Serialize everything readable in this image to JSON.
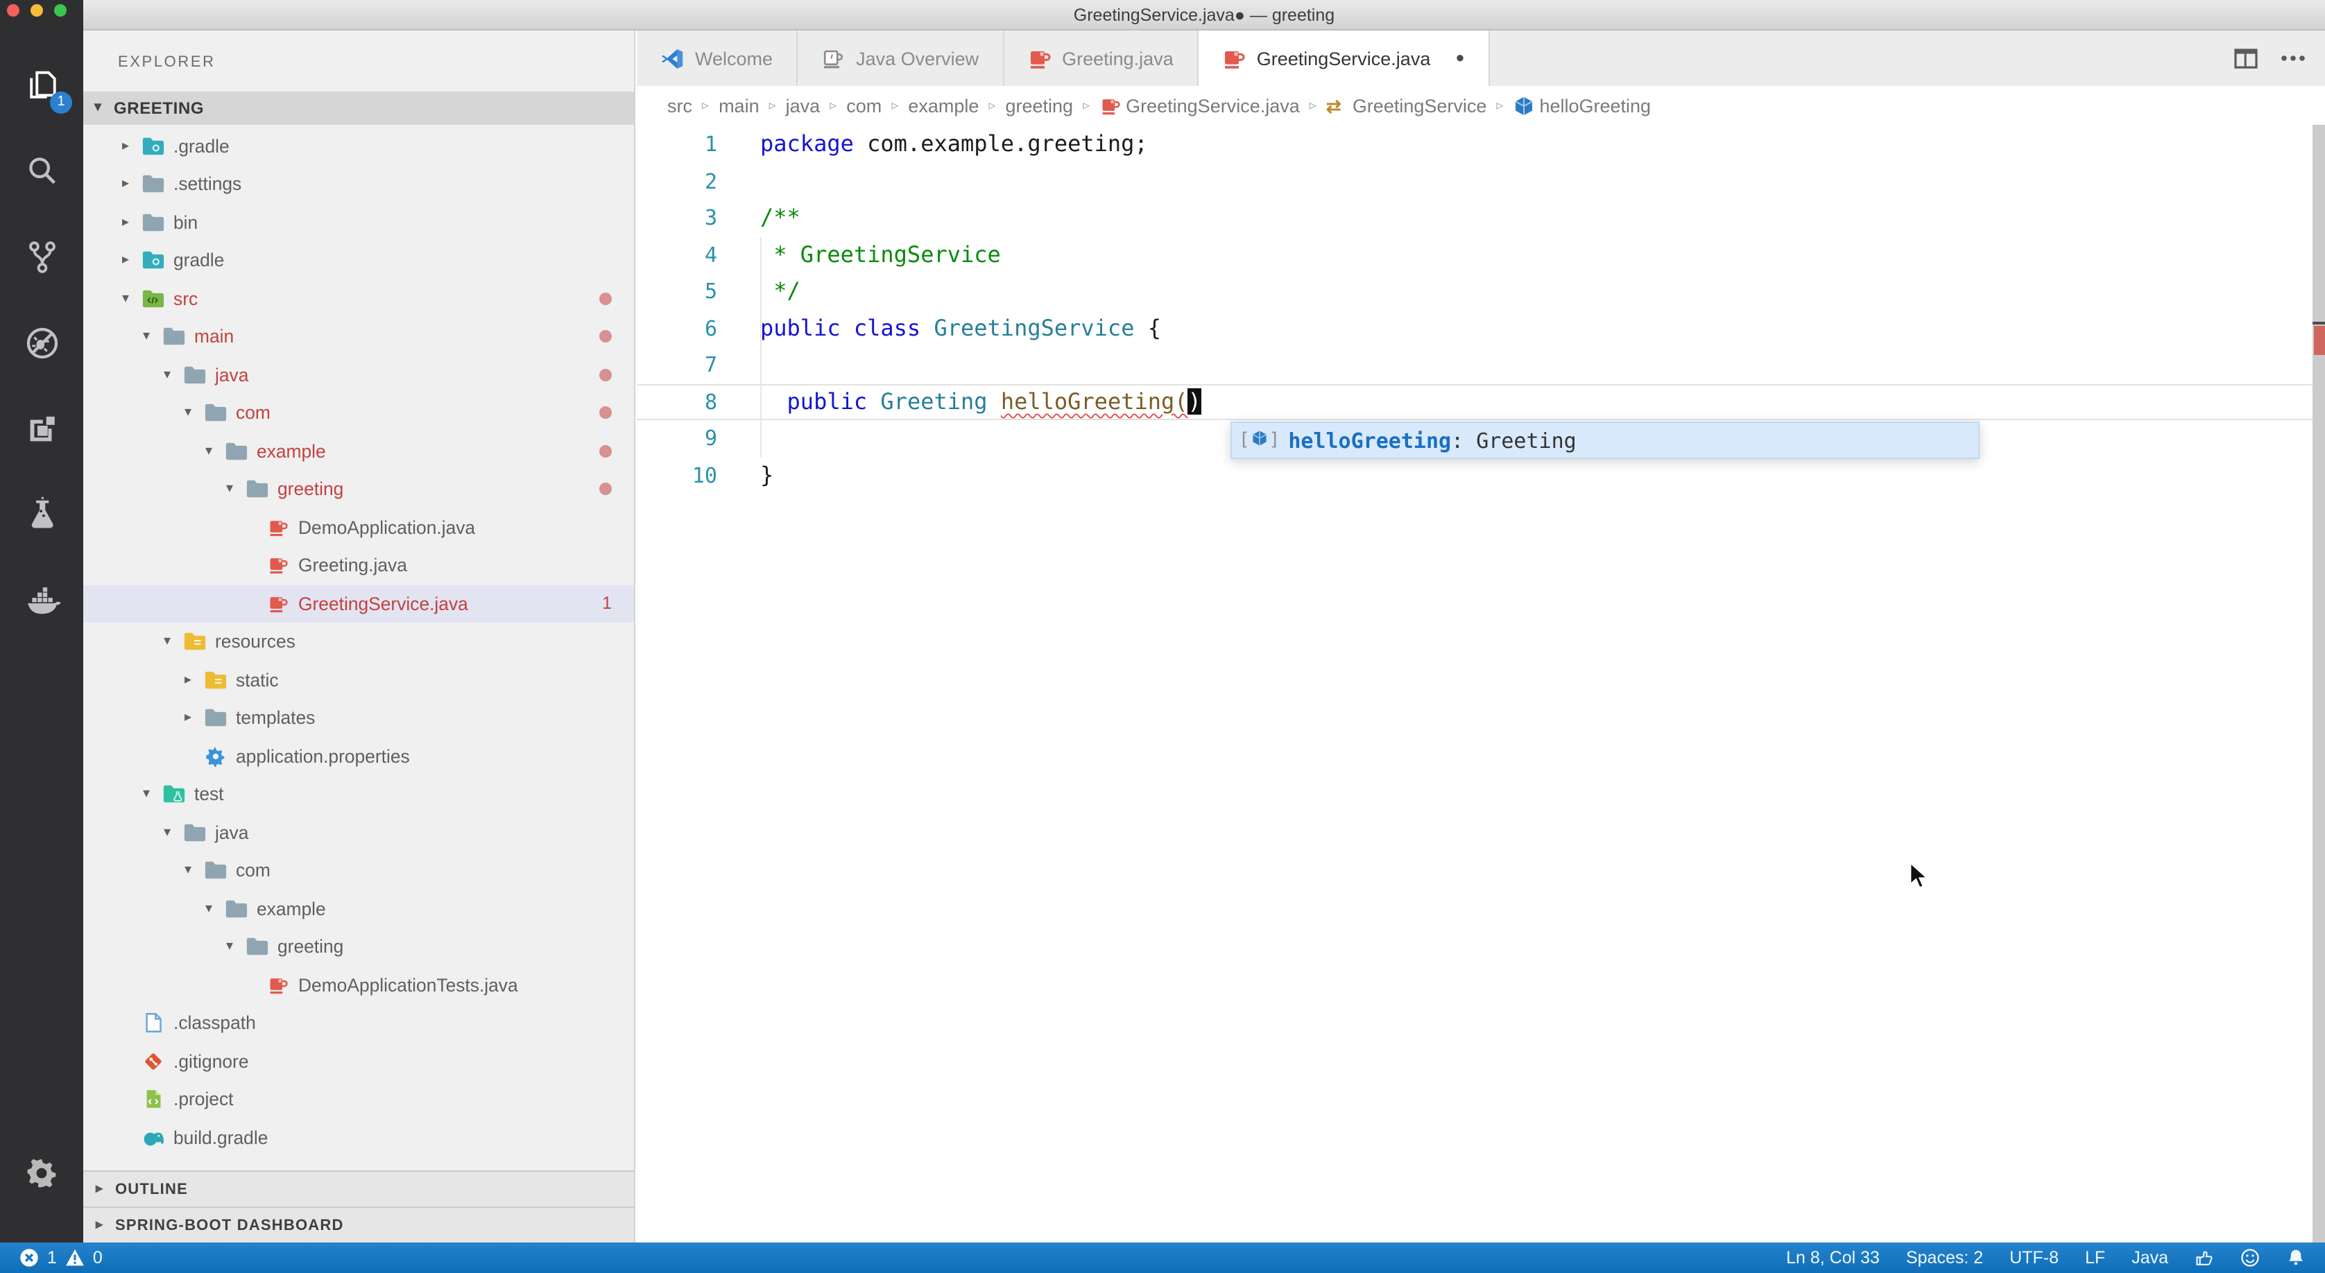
{
  "window": {
    "title": "GreetingService.java● — greeting"
  },
  "activity_bar": {
    "items": [
      {
        "name": "files",
        "active": true,
        "badge": "1"
      },
      {
        "name": "search"
      },
      {
        "name": "source-control"
      },
      {
        "name": "debug"
      },
      {
        "name": "extensions"
      },
      {
        "name": "test"
      },
      {
        "name": "docker"
      }
    ],
    "settings": {
      "name": "settings-gear"
    }
  },
  "sidebar": {
    "title": "EXPLORER",
    "section": "GREETING",
    "tree": [
      {
        "label": ".gradle",
        "level": 1,
        "icon": "gradle-folder",
        "arrow": "closed"
      },
      {
        "label": ".settings",
        "level": 1,
        "icon": "folder",
        "arrow": "closed"
      },
      {
        "label": "bin",
        "level": 1,
        "icon": "folder",
        "arrow": "closed"
      },
      {
        "label": "gradle",
        "level": 1,
        "icon": "gradle-folder",
        "arrow": "closed"
      },
      {
        "label": "src",
        "level": 1,
        "icon": "src-folder",
        "arrow": "open",
        "red": true,
        "dot": true
      },
      {
        "label": "main",
        "level": 2,
        "icon": "folder",
        "arrow": "open",
        "red": true,
        "dot": true
      },
      {
        "label": "java",
        "level": 3,
        "icon": "folder",
        "arrow": "open",
        "red": true,
        "dot": true
      },
      {
        "label": "com",
        "level": 4,
        "icon": "folder",
        "arrow": "open",
        "red": true,
        "dot": true
      },
      {
        "label": "example",
        "level": 5,
        "icon": "folder",
        "arrow": "open",
        "red": true,
        "dot": true
      },
      {
        "label": "greeting",
        "level": 6,
        "icon": "folder",
        "arrow": "open",
        "red": true,
        "dot": true
      },
      {
        "label": "DemoApplication.java",
        "level": 7,
        "icon": "java-file",
        "arrow": "none"
      },
      {
        "label": "Greeting.java",
        "level": 7,
        "icon": "java-file",
        "arrow": "none"
      },
      {
        "label": "GreetingService.java",
        "level": 7,
        "icon": "java-file",
        "arrow": "none",
        "red": true,
        "selected": true,
        "badge": "1"
      },
      {
        "label": "resources",
        "level": 3,
        "icon": "resources-folder",
        "arrow": "open"
      },
      {
        "label": "static",
        "level": 4,
        "icon": "resources-folder",
        "arrow": "closed"
      },
      {
        "label": "templates",
        "level": 4,
        "icon": "folder",
        "arrow": "closed"
      },
      {
        "label": "application.properties",
        "level": 4,
        "icon": "gear-file",
        "arrow": "none"
      },
      {
        "label": "test",
        "level": 2,
        "icon": "test-folder",
        "arrow": "open"
      },
      {
        "label": "java",
        "level": 3,
        "icon": "folder",
        "arrow": "open"
      },
      {
        "label": "com",
        "level": 4,
        "icon": "folder",
        "arrow": "open"
      },
      {
        "label": "example",
        "level": 5,
        "icon": "folder",
        "arrow": "open"
      },
      {
        "label": "greeting",
        "level": 6,
        "icon": "folder",
        "arrow": "open"
      },
      {
        "label": "DemoApplicationTests.java",
        "level": 7,
        "icon": "java-file",
        "arrow": "none"
      },
      {
        "label": ".classpath",
        "level": 1,
        "icon": "file",
        "arrow": "none"
      },
      {
        "label": ".gitignore",
        "level": 1,
        "icon": "git",
        "arrow": "none"
      },
      {
        "label": ".project",
        "level": 1,
        "icon": "project-file",
        "arrow": "none"
      },
      {
        "label": "build.gradle",
        "level": 1,
        "icon": "gradle-elephant",
        "arrow": "none"
      }
    ],
    "bottom_sections": [
      {
        "label": "OUTLINE"
      },
      {
        "label": "SPRING-BOOT DASHBOARD"
      }
    ]
  },
  "editor": {
    "tabs": [
      {
        "label": "Welcome",
        "icon": "vscode-logo"
      },
      {
        "label": "Java Overview",
        "icon": "java-overview"
      },
      {
        "label": "Greeting.java",
        "icon": "java-file"
      },
      {
        "label": "GreetingService.java",
        "icon": "java-file",
        "active": true,
        "dirty": true
      }
    ],
    "breadcrumb": [
      {
        "label": "src"
      },
      {
        "label": "main"
      },
      {
        "label": "java"
      },
      {
        "label": "com"
      },
      {
        "label": "example"
      },
      {
        "label": "greeting"
      },
      {
        "label": "GreetingService.java",
        "icon": "java-file"
      },
      {
        "label": "GreetingService",
        "icon": "class-symbol"
      },
      {
        "label": "helloGreeting",
        "icon": "method-symbol"
      }
    ],
    "code": {
      "lines": [
        {
          "n": "1",
          "tokens": [
            {
              "text": "package ",
              "scope": "keyword"
            },
            {
              "text": "com.example.greeting;",
              "scope": "plain"
            }
          ]
        },
        {
          "n": "2",
          "tokens": []
        },
        {
          "n": "3",
          "tokens": [
            {
              "text": "/**",
              "scope": "comment"
            }
          ]
        },
        {
          "n": "4",
          "tokens": [
            {
              "text": " * GreetingService",
              "scope": "comment"
            }
          ]
        },
        {
          "n": "5",
          "tokens": [
            {
              "text": " */",
              "scope": "comment"
            }
          ]
        },
        {
          "n": "6",
          "tokens": [
            {
              "text": "public class ",
              "scope": "keyword"
            },
            {
              "text": "GreetingService",
              "scope": "type"
            },
            {
              "text": " {",
              "scope": "plain"
            }
          ]
        },
        {
          "n": "7",
          "tokens": []
        },
        {
          "n": "8",
          "current": true,
          "tokens": [
            {
              "text": "  ",
              "scope": "plain"
            },
            {
              "text": "public ",
              "scope": "keyword"
            },
            {
              "text": "Greeting",
              "scope": "type"
            },
            {
              "text": " ",
              "scope": "plain"
            },
            {
              "text": "helloGreeting(",
              "scope": "method",
              "squiggle": true
            },
            {
              "text": ")",
              "scope": "plain",
              "cursor": true
            }
          ]
        },
        {
          "n": "9",
          "tokens": []
        },
        {
          "n": "10",
          "tokens": [
            {
              "text": "}",
              "scope": "plain"
            }
          ]
        }
      ]
    },
    "suggest": {
      "name": "helloGreeting",
      "detail": " : Greeting",
      "kind": "method-symbol"
    }
  },
  "status_bar": {
    "errors": "1",
    "warnings": "0",
    "items": [
      "Ln 8, Col 33",
      "Spaces: 2",
      "UTF-8",
      "LF",
      "Java"
    ],
    "icons": [
      "thumbs-up",
      "smiley",
      "bell"
    ]
  },
  "colors": {
    "statusbar_blue": "#1478c8",
    "error_red": "#c3423f",
    "selection_row": "#e2e4f1",
    "java_file_red": "#e25a4d",
    "activity_bg": "#2f2f31"
  }
}
